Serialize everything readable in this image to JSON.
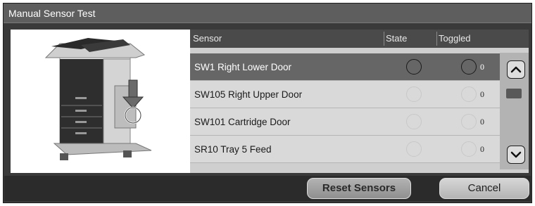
{
  "window": {
    "title": "Manual Sensor Test"
  },
  "image": {
    "label": "printer-sensor-location"
  },
  "table": {
    "headers": {
      "sensor": "Sensor",
      "state": "State",
      "toggled": "Toggled"
    },
    "rows": [
      {
        "name": "SW1 Right Lower Door",
        "count": "0",
        "selected": true
      },
      {
        "name": "SW105 Right Upper Door",
        "count": "0",
        "selected": false
      },
      {
        "name": "SW101 Cartridge Door",
        "count": "0",
        "selected": false
      },
      {
        "name": "SR10 Tray 5 Feed",
        "count": "0",
        "selected": false
      }
    ]
  },
  "scrollbar": {
    "up_icon": "chevron-up-icon",
    "down_icon": "chevron-down-icon"
  },
  "buttons": {
    "reset": "Reset Sensors",
    "cancel": "Cancel"
  }
}
